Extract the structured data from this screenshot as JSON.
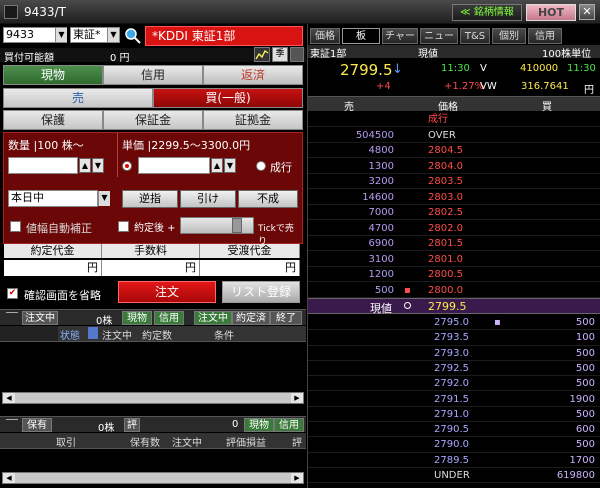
{
  "window": {
    "title": "9433/T",
    "info_button": "≪ 銘柄情報",
    "hot_button": "HOT",
    "close_button": "✕"
  },
  "symbol": {
    "code": "9433",
    "market": "東証*",
    "name": "*KDDI 東証1部"
  },
  "buying_power": {
    "label": "買付可能額",
    "value": "0 円"
  },
  "trade_tabs": [
    "現物",
    "信用",
    "返済"
  ],
  "side_tabs": {
    "sell": "売",
    "buy": "買(一般)"
  },
  "sub_tabs": [
    "保護",
    "保証金",
    "証拠金"
  ],
  "order": {
    "qty_label": "数量 |100 株～",
    "price_label": "単価 |2299.5～3300.0円",
    "qty_value": "",
    "price_value": "",
    "market_order_label": "成行",
    "expiry": "本日中",
    "buttons": [
      "逆指",
      "引け",
      "不成"
    ],
    "auto_correct_label": "値幅自動補正",
    "after_fill_label": "約定後 +",
    "tick_sell_label": "Tickで売り"
  },
  "summary": {
    "headers": [
      "約定代金",
      "手数料",
      "受渡代金"
    ],
    "values": [
      "円",
      "円",
      "円"
    ]
  },
  "confirm_skip_label": "確認画面を省略",
  "order_button": "注文",
  "list_button": "リスト登録",
  "orders_section": {
    "header_left": "注文中",
    "count": "0株",
    "tabs": [
      "現物",
      "信用",
      "注文中",
      "約定済",
      "終了"
    ],
    "columns": [
      "状態",
      "注文中",
      "約定数",
      "条件"
    ]
  },
  "holdings_section": {
    "header_left": "保有",
    "count": "0株",
    "eval_label": "評",
    "zero": "0",
    "tabs": [
      "現物",
      "信用"
    ],
    "columns": [
      "取引",
      "保有数",
      "注文中",
      "評価損益",
      "評"
    ]
  },
  "board": {
    "tabs": [
      "価格",
      "板",
      "チャート",
      "ニュース",
      "T&S",
      "個別",
      "信用"
    ],
    "market": "東証1部",
    "current_label": "現値",
    "unit": "100株単位",
    "price": "2799.5",
    "arrow": "↓",
    "time1": "11:30",
    "v_label": "V",
    "volume": "410000",
    "time2": "11:30",
    "change": "+4",
    "change_pct": "+1.27%",
    "vw_label": "VW",
    "vwap": "316.7641",
    "pm": "円",
    "col_sell": "売",
    "col_price": "価格",
    "col_buy": "買",
    "asks": [
      {
        "qty": "",
        "price": "成行"
      },
      {
        "qty": "504500",
        "price": "OVER"
      },
      {
        "qty": "4800",
        "price": "2804.5"
      },
      {
        "qty": "1300",
        "price": "2804.0"
      },
      {
        "qty": "3200",
        "price": "2803.5"
      },
      {
        "qty": "14600",
        "price": "2803.0"
      },
      {
        "qty": "7000",
        "price": "2802.5"
      },
      {
        "qty": "4700",
        "price": "2802.0"
      },
      {
        "qty": "6900",
        "price": "2801.5"
      },
      {
        "qty": "3100",
        "price": "2801.0"
      },
      {
        "qty": "1200",
        "price": "2800.5"
      },
      {
        "qty": "500",
        "price": "2800.0"
      }
    ],
    "current_row": {
      "label": "現値",
      "price": "2799.5"
    },
    "bids": [
      {
        "price": "2795.0",
        "qty": "500"
      },
      {
        "price": "2793.5",
        "qty": "100"
      },
      {
        "price": "2793.0",
        "qty": "500"
      },
      {
        "price": "2792.5",
        "qty": "500"
      },
      {
        "price": "2792.0",
        "qty": "500"
      },
      {
        "price": "2791.5",
        "qty": "1900"
      },
      {
        "price": "2791.0",
        "qty": "500"
      },
      {
        "price": "2790.5",
        "qty": "600"
      },
      {
        "price": "2790.0",
        "qty": "500"
      },
      {
        "price": "2789.5",
        "qty": "1700"
      },
      {
        "price": "UNDER",
        "qty": "619800"
      }
    ]
  }
}
